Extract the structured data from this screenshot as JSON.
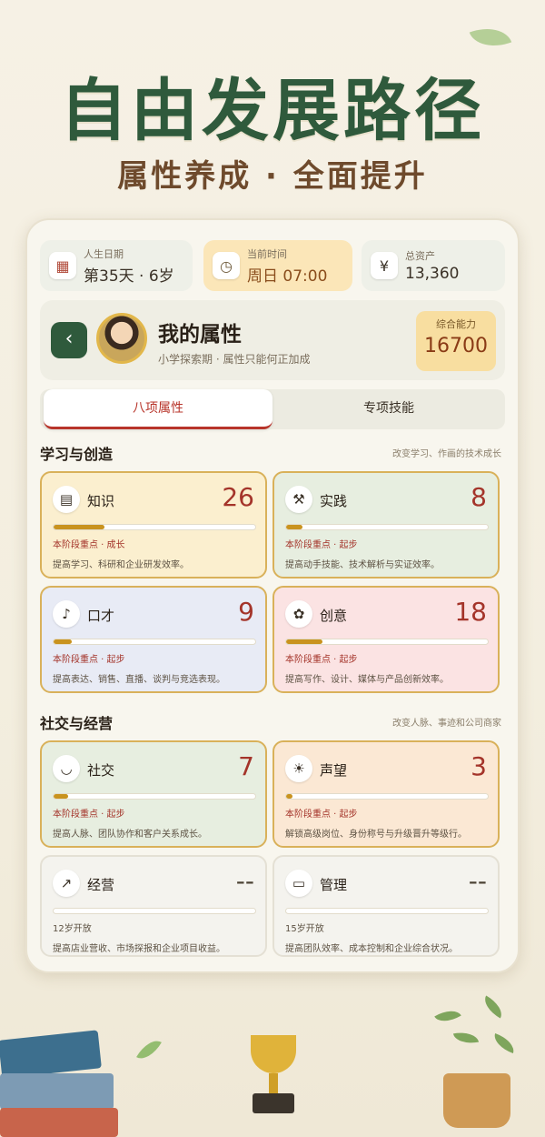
{
  "hero": {
    "title": "自由发展路径",
    "subtitle": "属性养成 · 全面提升"
  },
  "stats": [
    {
      "label": "人生日期",
      "value": "第35天 · 6岁",
      "icon": "calendar-icon"
    },
    {
      "label": "当前时间",
      "value": "周日 07:00",
      "icon": "clock-icon"
    },
    {
      "label": "总资产",
      "value": "13,360",
      "icon": "yen-icon"
    }
  ],
  "profile": {
    "name": "我的属性",
    "subtitle": "小学探索期 · 属性只能何正加成",
    "power_label": "综合能力",
    "power_value": "16700"
  },
  "tabs": {
    "active": "八项属性",
    "inactive": "专项技能"
  },
  "sections": {
    "study": {
      "title": "学习与创造",
      "note": "改变学习、作画的技术成长"
    },
    "social": {
      "title": "社交与经营",
      "note": "改变人脉、事迹和公司商家"
    }
  },
  "attributes": [
    {
      "name": "知识",
      "value": "26",
      "icon": "books-icon",
      "stage": "本阶段重点 · 成长",
      "desc": "提高学习、科研和企业研发效率。",
      "progress": 0.25,
      "bg": "#fbefcf"
    },
    {
      "name": "实践",
      "value": "8",
      "icon": "tools-icon",
      "stage": "本阶段重点 · 起步",
      "desc": "提高动手技能、技术解析与实证效率。",
      "progress": 0.08,
      "bg": "#e7eee0"
    },
    {
      "name": "口才",
      "value": "9",
      "icon": "microphone-icon",
      "stage": "本阶段重点 · 起步",
      "desc": "提高表达、销售、直播、谈判与竞选表现。",
      "progress": 0.09,
      "bg": "#e8ebf5"
    },
    {
      "name": "创意",
      "value": "18",
      "icon": "palette-icon",
      "stage": "本阶段重点 · 起步",
      "desc": "提高写作、设计、媒体与产品创新效率。",
      "progress": 0.18,
      "bg": "#fbe3e3"
    },
    {
      "name": "社交",
      "value": "7",
      "icon": "handshake-icon",
      "stage": "本阶段重点 · 起步",
      "desc": "提高人脉、团队协作和客户关系成长。",
      "progress": 0.07,
      "bg": "#e7eee0"
    },
    {
      "name": "声望",
      "value": "3",
      "icon": "sun-icon",
      "stage": "本阶段重点 · 起步",
      "desc": "解锁高级岗位、身份称号与升级晋升等级行。",
      "progress": 0.03,
      "bg": "#fbe8d4"
    },
    {
      "name": "经营",
      "value": "--",
      "icon": "chart-icon",
      "stage": "12岁开放",
      "desc": "提高店业营收、市场探报和企业项目收益。",
      "progress": 0,
      "bg": "#f4f3ee"
    },
    {
      "name": "管理",
      "value": "--",
      "icon": "clipboard-icon",
      "stage": "15岁开放",
      "desc": "提高团队效率、成本控制和企业综合状况。",
      "progress": 0,
      "bg": "#f4f3ee"
    }
  ],
  "colors": {
    "accent_green": "#2f5a3c",
    "accent_red": "#a4342a",
    "gold": "#d9b15a"
  }
}
